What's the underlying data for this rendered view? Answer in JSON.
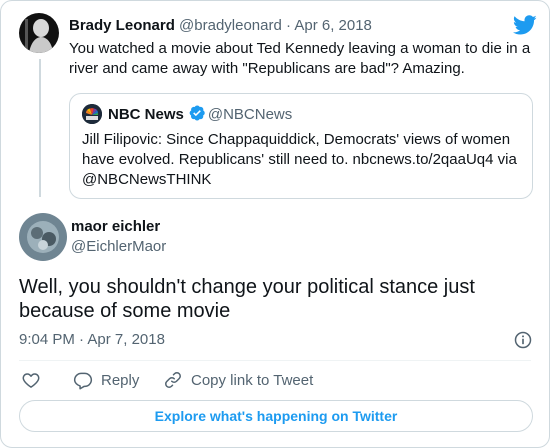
{
  "parent_tweet": {
    "author_name": "Brady Leonard",
    "handle": "@bradyleonard",
    "separator": "·",
    "date": "Apr 6, 2018",
    "text": "You watched a movie about Ted Kennedy leaving a woman to die in a river and came away with \"Republicans are bad\"? Amazing."
  },
  "quoted_tweet": {
    "author_name": "NBC News",
    "handle": "@NBCNews",
    "text": "Jill Filipovic: Since Chappaquiddick, Democrats' views of women have evolved. Republicans' still need to. nbcnews.to/2qaaUq4 via @NBCNewsTHINK"
  },
  "reply_tweet": {
    "author_name": "maor eichler",
    "handle": "@EichlerMaor",
    "text": "Well, you shouldn't change your political stance just because of some movie",
    "time": "9:04 PM",
    "separator": "·",
    "date": "Apr 7, 2018"
  },
  "actions": {
    "reply_label": "Reply",
    "copy_link_label": "Copy link to Tweet"
  },
  "explore_label": "Explore what's happening on Twitter",
  "colors": {
    "accent": "#1d9bf0",
    "text": "#0f1419",
    "muted": "#536471",
    "border": "#cfd9de"
  },
  "icons": [
    "twitter-bird-icon",
    "verified-badge-icon",
    "info-icon",
    "heart-icon",
    "reply-icon",
    "link-icon"
  ]
}
